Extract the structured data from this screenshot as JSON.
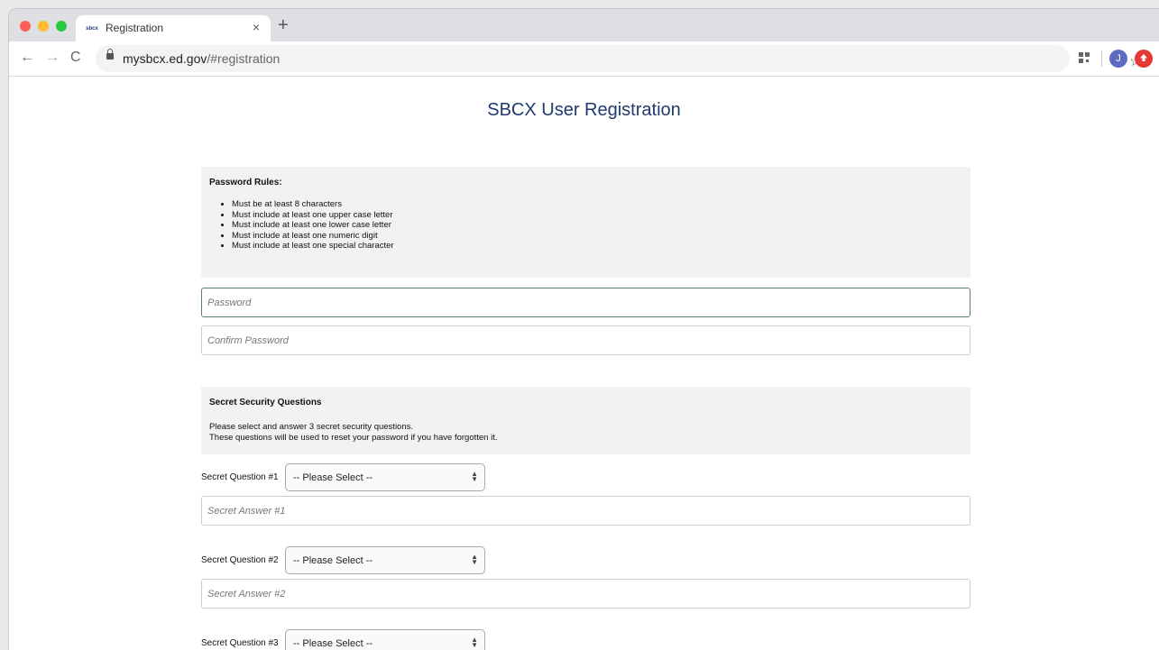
{
  "browser": {
    "tab_title": "Registration",
    "tab_favicon_text": "sbcx",
    "tab_close": "×",
    "new_tab": "+",
    "nav_back": "←",
    "nav_forward": "→",
    "nav_reload": "C",
    "url_host": "mysbcx.ed.gov",
    "url_path": "/#registration",
    "star": "☆",
    "profile_initial": "J"
  },
  "page": {
    "title": "SBCX User Registration",
    "password_rules": {
      "heading": "Password Rules:",
      "items": [
        "Must be at least 8 characters",
        "Must include at least one upper case letter",
        "Must include at least one lower case letter",
        "Must include at least one numeric digit",
        "Must include at least one special character"
      ]
    },
    "password_placeholder": "Password",
    "confirm_password_placeholder": "Confirm Password",
    "security": {
      "heading": "Secret Security Questions",
      "line1": "Please select and answer 3 secret security questions.",
      "line2": "These questions will be used to reset your password if you have forgotten it."
    },
    "questions": [
      {
        "label": "Secret Question #1",
        "selected": "-- Please Select --",
        "answer_placeholder": "Secret Answer #1"
      },
      {
        "label": "Secret Question #2",
        "selected": "-- Please Select --",
        "answer_placeholder": "Secret Answer #2"
      },
      {
        "label": "Secret Question #3",
        "selected": "-- Please Select --"
      }
    ]
  }
}
